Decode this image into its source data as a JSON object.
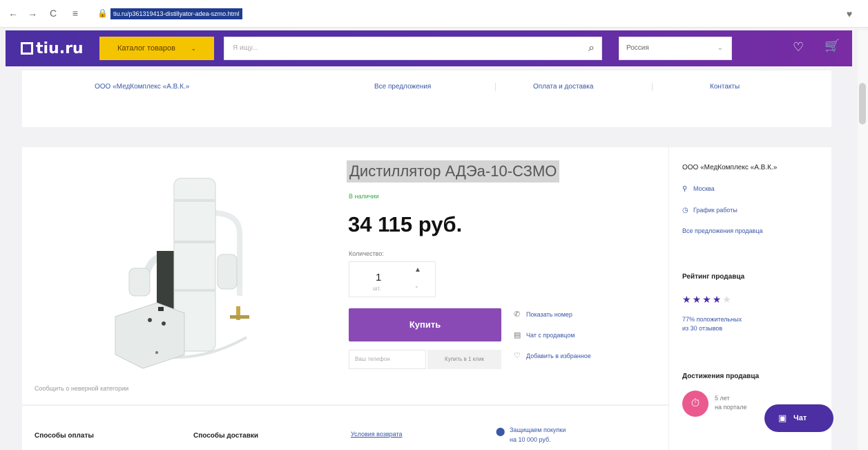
{
  "browser": {
    "url": "tiu.ru/p361319413-distillyator-adea-szmo.html",
    "back_icon": "←",
    "forward_icon": "→",
    "reload_icon": "C",
    "reader_icon": "≡",
    "lock_icon": "🔒",
    "shield_icon": "♥"
  },
  "header": {
    "logo": "tiu.ru",
    "catalog_label": "Каталог товаров",
    "catalog_caret": "⌄",
    "search_placeholder": "Я ищу...",
    "search_icon": "⌕",
    "region": "Россия",
    "region_caret": "⌄",
    "favorites_icon": "♡",
    "cart_icon": "🛒"
  },
  "storenav": {
    "items": [
      "ООО «МедКомплекс «А.В.К.»",
      "Все предложения",
      "Оплата и доставка",
      "Контакты"
    ]
  },
  "product": {
    "title": "Дистиллятор АДЭа-10-СЗМО",
    "stock": "В наличии",
    "price": "34 115 руб.",
    "qty_label": "Количество:",
    "qty_value": "1",
    "qty_unit": "шт.",
    "qty_up": "▲",
    "qty_down": "⌄",
    "buy_label": "Купить",
    "phone_placeholder": "Ваш телефон",
    "oneclick_label": "Купить в 1 клик",
    "report_link": "Сообщить о неверной категории",
    "actions": [
      {
        "icon": "✆",
        "label": "Показать номер"
      },
      {
        "icon": "▤",
        "label": "Чат с продавцом"
      },
      {
        "icon": "♡",
        "label": "Добавить в избранное"
      }
    ]
  },
  "lower": {
    "payment_title": "Способы оплаты",
    "delivery_title": "Способы доставки",
    "return_link": "Условия возврата",
    "protect_icon": "⬤",
    "protect_line1": "Защищаем покупки",
    "protect_line2": "на 10 000 руб."
  },
  "seller": {
    "name": "ООО «МедКомплекс «А.В.К.»",
    "city": "Москва",
    "schedule": "График работы",
    "all_offers": "Все предложения продавца",
    "city_icon": "⚲",
    "schedule_icon": "◷",
    "rating_title": "Рейтинг продавца",
    "stars_filled": 4,
    "stars_total": 5,
    "rating_line1": "77% положительных",
    "rating_line2": "из 30 отзывов",
    "achievements_title": "Достижения продавца",
    "badge_icon": "⏱",
    "badge_line1": "5 лет",
    "badge_line2": "на портале"
  },
  "chat": {
    "label": "Чат",
    "icon": "▣"
  },
  "colors": {
    "brand": "#4b2fa3",
    "catalog": "#f5c400",
    "buy": "#8a4ab5",
    "link": "#3a57a8",
    "in_stock": "#3aa845"
  }
}
